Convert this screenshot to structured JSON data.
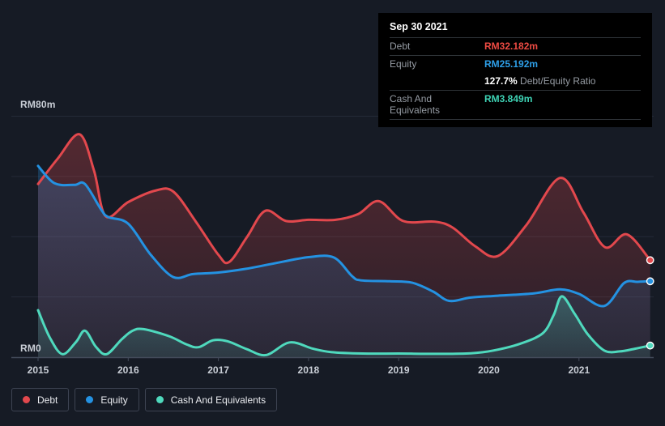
{
  "colors": {
    "background": "#161b25",
    "debt": "#e2484d",
    "equity": "#2492e2",
    "cash": "#4fd9bd",
    "axis_text": "#c9ced6",
    "tooltip_background": "#000000",
    "tooltip_label": "#969ca4"
  },
  "tooltip": {
    "date": "Sep 30 2021",
    "rows": [
      {
        "label": "Debt",
        "value": "RM32.182m",
        "color": "#ee4b43"
      },
      {
        "label": "Equity",
        "value": "RM25.192m",
        "color": "#2e9fe8"
      },
      {
        "label": "Cash And Equivalents",
        "value": "RM3.849m",
        "color": "#3ed3b5"
      }
    ],
    "ratio_bold": "127.7%",
    "ratio_text": "Debt/Equity Ratio"
  },
  "chart_data": {
    "type": "area",
    "title": "",
    "xlabel": "",
    "ylabel": "",
    "unit_prefix": "RM",
    "unit_suffix": "m",
    "x_axis": {
      "tick_labels": [
        "2015",
        "2016",
        "2017",
        "2018",
        "2019",
        "2020",
        "2021"
      ],
      "start_year": 2015,
      "end_year": 2021.79
    },
    "y_axis": {
      "min": 0,
      "max": 80,
      "min_label": "RM0",
      "max_label": "RM80m",
      "gridline_values": [
        80,
        60,
        40,
        20
      ]
    },
    "legend_position": "bottom-left",
    "grid": true,
    "series": [
      {
        "name": "Debt",
        "color": "#e2484d",
        "fill_opacity_top": 0.3,
        "fill_opacity_bottom": 0.1,
        "points": [
          [
            2015.0,
            57.5
          ],
          [
            2015.22,
            66
          ],
          [
            2015.46,
            74
          ],
          [
            2015.62,
            62
          ],
          [
            2015.75,
            46.8
          ],
          [
            2016.0,
            51.5
          ],
          [
            2016.3,
            55.3
          ],
          [
            2016.5,
            55
          ],
          [
            2016.75,
            45
          ],
          [
            2017.0,
            34
          ],
          [
            2017.12,
            31.6
          ],
          [
            2017.32,
            40
          ],
          [
            2017.52,
            48.6
          ],
          [
            2017.75,
            45.2
          ],
          [
            2018.0,
            45.6
          ],
          [
            2018.3,
            45.6
          ],
          [
            2018.55,
            47.5
          ],
          [
            2018.78,
            51.8
          ],
          [
            2019.05,
            45.2
          ],
          [
            2019.4,
            45
          ],
          [
            2019.6,
            43
          ],
          [
            2019.85,
            36.8
          ],
          [
            2020.1,
            33.6
          ],
          [
            2020.42,
            44
          ],
          [
            2020.79,
            59.5
          ],
          [
            2021.05,
            48
          ],
          [
            2021.29,
            36.5
          ],
          [
            2021.53,
            40.8
          ],
          [
            2021.79,
            32.182
          ]
        ]
      },
      {
        "name": "Equity",
        "color": "#2492e2",
        "fill_opacity_top": 0.26,
        "fill_opacity_bottom": 0.07,
        "points": [
          [
            2015.0,
            63.5
          ],
          [
            2015.18,
            57.8
          ],
          [
            2015.4,
            57.2
          ],
          [
            2015.52,
            57.5
          ],
          [
            2015.7,
            49
          ],
          [
            2015.78,
            46.5
          ],
          [
            2016.0,
            44.3
          ],
          [
            2016.25,
            34
          ],
          [
            2016.5,
            26.6
          ],
          [
            2016.72,
            27.6
          ],
          [
            2017.0,
            28.1
          ],
          [
            2017.3,
            29.3
          ],
          [
            2017.6,
            31
          ],
          [
            2018.0,
            33.2
          ],
          [
            2018.28,
            33.1
          ],
          [
            2018.48,
            27
          ],
          [
            2018.58,
            25.5
          ],
          [
            2018.9,
            25.2
          ],
          [
            2019.15,
            24.7
          ],
          [
            2019.38,
            21.8
          ],
          [
            2019.56,
            18.7
          ],
          [
            2019.8,
            19.8
          ],
          [
            2020.1,
            20.4
          ],
          [
            2020.5,
            21.2
          ],
          [
            2020.79,
            22.5
          ],
          [
            2021.0,
            21
          ],
          [
            2021.28,
            17
          ],
          [
            2021.5,
            24.6
          ],
          [
            2021.65,
            25
          ],
          [
            2021.79,
            25.192
          ]
        ]
      },
      {
        "name": "Cash And Equivalents",
        "color": "#4fd9bd",
        "fill_opacity_top": 0.26,
        "fill_opacity_bottom": 0.1,
        "points": [
          [
            2015.0,
            15.6
          ],
          [
            2015.13,
            6.5
          ],
          [
            2015.27,
            1.0
          ],
          [
            2015.42,
            5
          ],
          [
            2015.52,
            8.8
          ],
          [
            2015.64,
            3.5
          ],
          [
            2015.76,
            1.0
          ],
          [
            2015.93,
            6
          ],
          [
            2016.05,
            8.8
          ],
          [
            2016.17,
            9.3
          ],
          [
            2016.45,
            7
          ],
          [
            2016.65,
            4.2
          ],
          [
            2016.78,
            3.3
          ],
          [
            2016.94,
            5.6
          ],
          [
            2017.1,
            5.3
          ],
          [
            2017.32,
            2.6
          ],
          [
            2017.53,
            0.7
          ],
          [
            2017.79,
            4.9
          ],
          [
            2018.05,
            2.8
          ],
          [
            2018.25,
            1.7
          ],
          [
            2018.6,
            1.2
          ],
          [
            2019.0,
            1.2
          ],
          [
            2019.45,
            1.1
          ],
          [
            2019.8,
            1.3
          ],
          [
            2020.05,
            2.2
          ],
          [
            2020.35,
            4.5
          ],
          [
            2020.6,
            8
          ],
          [
            2020.72,
            14
          ],
          [
            2020.81,
            20.2
          ],
          [
            2020.95,
            14.5
          ],
          [
            2021.1,
            7.5
          ],
          [
            2021.28,
            2.2
          ],
          [
            2021.45,
            1.9
          ],
          [
            2021.62,
            2.8
          ],
          [
            2021.79,
            3.849
          ]
        ]
      }
    ]
  }
}
